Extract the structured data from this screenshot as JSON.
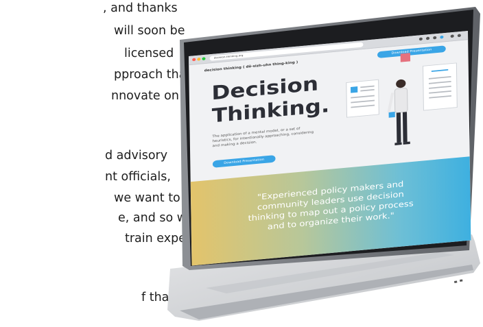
{
  "background_text": {
    "lines": [
      ", and thanks",
      "will soon be",
      "licensed",
      "pproach that",
      "nnovate on",
      "d advisory",
      "nt officials,",
      "we want to",
      "e, and so we",
      "train experts",
      "f that first"
    ]
  },
  "browser": {
    "url": "decision-thinking.org"
  },
  "site": {
    "logo": "decision thinking ( dē-sizh-uhn thing-king )",
    "top_button": "Download Presentation",
    "hero": {
      "title_line1": "Decision",
      "title_line2": "Thinking.",
      "description": "The application of a mental model, or a set of heuristics, for intentionally approaching, considering and making a decision.",
      "button": "Download Presentation"
    },
    "quote": {
      "line1": "\"Experienced policy makers and",
      "line2": "community leaders use decision",
      "line3": "thinking to map out a policy process",
      "line4": "and to organize their work.\""
    }
  },
  "colors": {
    "accent": "#3aa5e6",
    "gradient_start": "#e3c46b",
    "gradient_end": "#3eb0e0",
    "figure_accent": "#e5727f"
  }
}
